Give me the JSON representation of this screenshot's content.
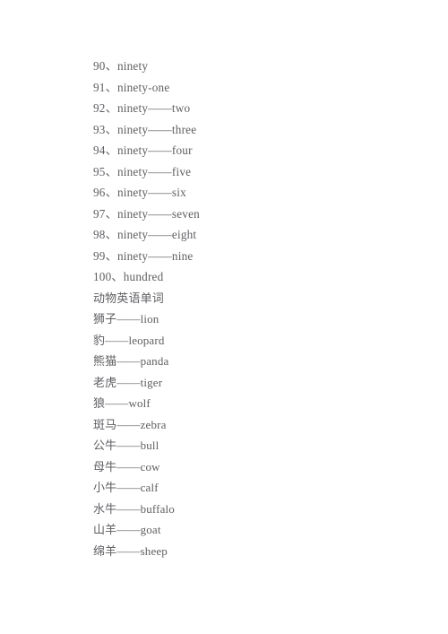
{
  "document": {
    "background_color": "#ffffff",
    "text_color": "#5f5f63",
    "lines": [
      {
        "id": "line-90",
        "text": "90、ninety",
        "kind": "numbered"
      },
      {
        "id": "line-91",
        "text": "91、ninety-one",
        "kind": "numbered"
      },
      {
        "id": "line-92",
        "text": "92、ninety——two",
        "kind": "numbered"
      },
      {
        "id": "line-93",
        "text": "93、ninety——three",
        "kind": "numbered"
      },
      {
        "id": "line-94",
        "text": "94、ninety——four",
        "kind": "numbered"
      },
      {
        "id": "line-95",
        "text": "95、ninety——five",
        "kind": "numbered"
      },
      {
        "id": "line-96",
        "text": "96、ninety——six",
        "kind": "numbered"
      },
      {
        "id": "line-97",
        "text": "97、ninety——seven",
        "kind": "numbered"
      },
      {
        "id": "line-98",
        "text": "98、ninety——eight",
        "kind": "numbered"
      },
      {
        "id": "line-99",
        "text": "99、ninety——nine",
        "kind": "numbered"
      },
      {
        "id": "line-100",
        "text": "100、hundred",
        "kind": "numbered"
      },
      {
        "id": "line-heading-animals",
        "text": "动物英语单词",
        "kind": "heading"
      },
      {
        "id": "line-lion",
        "text": "狮子——lion",
        "kind": "vocab"
      },
      {
        "id": "line-leopard",
        "text": "豹——leopard",
        "kind": "vocab"
      },
      {
        "id": "line-panda",
        "text": "熊猫——panda",
        "kind": "vocab"
      },
      {
        "id": "line-tiger",
        "text": "老虎——tiger",
        "kind": "vocab"
      },
      {
        "id": "line-wolf",
        "text": "狼——wolf",
        "kind": "vocab"
      },
      {
        "id": "line-zebra",
        "text": "斑马——zebra",
        "kind": "vocab"
      },
      {
        "id": "line-bull",
        "text": "公牛——bull",
        "kind": "vocab"
      },
      {
        "id": "line-cow",
        "text": "母牛——cow",
        "kind": "vocab"
      },
      {
        "id": "line-calf",
        "text": "小牛——calf",
        "kind": "vocab"
      },
      {
        "id": "line-buffalo",
        "text": "水牛——buffalo",
        "kind": "vocab"
      },
      {
        "id": "line-goat",
        "text": "山羊——goat",
        "kind": "vocab"
      },
      {
        "id": "line-sheep",
        "text": "绵羊——sheep",
        "kind": "vocab"
      }
    ]
  }
}
